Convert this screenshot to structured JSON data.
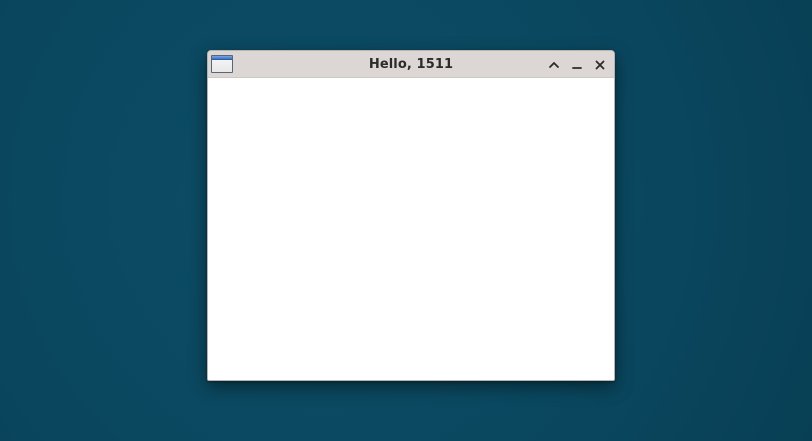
{
  "window": {
    "title": "Hello, 1511",
    "icons": {
      "app": "app-window-icon",
      "maximize": "chevron-up-icon",
      "minimize": "minimize-icon",
      "close": "close-icon"
    }
  },
  "colors": {
    "desktop_background": "#0b4a62",
    "titlebar": "#dcd7d4",
    "title_text": "#2b2b2b",
    "content_background": "#ffffff",
    "icon_accent": "#3c73c4"
  }
}
